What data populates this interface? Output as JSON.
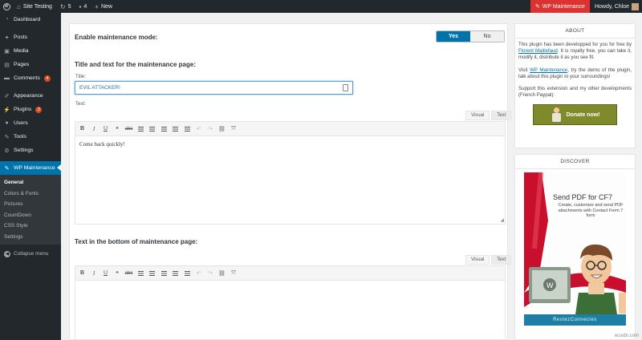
{
  "adminbar": {
    "site_name": "Site Testing",
    "updates_count": "5",
    "comments_count": "4",
    "new_label": "New",
    "maintenance_label": "WP Maintenance",
    "howdy": "Howdy, Chloe"
  },
  "sidebar": {
    "items": [
      {
        "label": "Dashboard",
        "icon": "dashboard-icon"
      },
      {
        "label": "Posts",
        "icon": "pin-icon"
      },
      {
        "label": "Media",
        "icon": "media-icon"
      },
      {
        "label": "Pages",
        "icon": "page-icon"
      },
      {
        "label": "Comments",
        "icon": "comment-icon",
        "badge": "4"
      },
      {
        "label": "Appearance",
        "icon": "brush-icon"
      },
      {
        "label": "Plugins",
        "icon": "plug-icon",
        "badge": "3"
      },
      {
        "label": "Users",
        "icon": "users-icon"
      },
      {
        "label": "Tools",
        "icon": "wrench-icon"
      },
      {
        "label": "Settings",
        "icon": "settings-icon"
      },
      {
        "label": "WP Maintenance",
        "icon": "wrench-icon"
      }
    ],
    "submenu": [
      "General",
      "Colors & Fonts",
      "Pictures",
      "CountDown",
      "CSS Style",
      "Settings"
    ],
    "collapse_label": "Collapse menu"
  },
  "main": {
    "enable_label": "Enable maintenance mode:",
    "toggle_yes": "Yes",
    "toggle_no": "No",
    "section_title": "Title and text for the maintenance page:",
    "title_label": "Title:",
    "title_value": "EVIL ATTACKER!",
    "text_label": "Text:",
    "tab_visual": "Visual",
    "tab_text": "Text",
    "editor_content": "Come back quickly!",
    "bottom_section_title": "Text in the bottom of maintenance page:"
  },
  "about": {
    "heading": "ABOUT",
    "p1_before": "This plugin has been developped for you for free by ",
    "p1_link": "Florent Maillefaud",
    "p1_after": ". It is royalty free, you can take it, modify it, distribute it as you see fit.",
    "p2_before": "Visit ",
    "p2_link": "WP Maintenance",
    "p2_after": ", try the demo of the plugin, talk about this plugin to your surroundings!",
    "p3": "Support this extension and my other developments (French Paypal):",
    "donate_label": "Donate now!"
  },
  "discover": {
    "heading": "DISCOVER",
    "ad_title": "Send PDF for CF7",
    "ad_subtitle": "Create, customize and send PDF attachments with Contact Form 7 form",
    "ad_footer": "RestezConnectes"
  },
  "watermark": "wsxdn.com",
  "colors": {
    "admin_bar": "#23282d",
    "accent": "#0073aa",
    "maintenance_red": "#dc3232",
    "donate_green": "#7f8a2b"
  }
}
